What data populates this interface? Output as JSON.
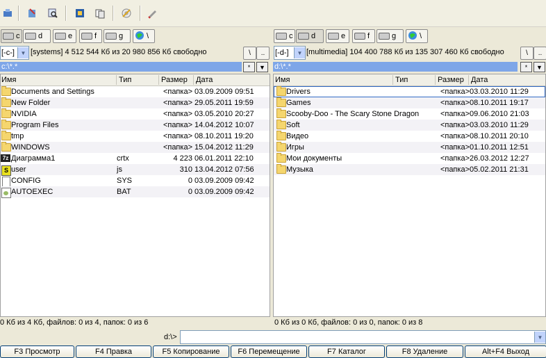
{
  "toolbar": {
    "buttons": [
      {
        "name": "network-icon"
      },
      {
        "name": "tools-icon"
      },
      {
        "name": "search-icon"
      },
      {
        "name": "windows-icon"
      },
      {
        "name": "copy-files-icon"
      },
      {
        "name": "cd-burn-icon"
      },
      {
        "name": "pen-icon"
      }
    ]
  },
  "left": {
    "drives": [
      {
        "label": "c",
        "selected": true
      },
      {
        "label": "d",
        "selected": false
      },
      {
        "label": "e",
        "selected": false
      },
      {
        "label": "f",
        "selected": false
      },
      {
        "label": "g",
        "selected": false
      },
      {
        "label": "\\",
        "selected": false
      }
    ],
    "drive_combo": "[-c-]",
    "volume_info": "[systems]  4 512 544 Кб из 20 980 856 Кб свободно",
    "path": "c:\\*.*",
    "columns": {
      "name": "Имя",
      "ext": "Тип",
      "size": "Размер",
      "date": "Дата"
    },
    "files": [
      {
        "icon": "folder",
        "name": "Documents and Settings",
        "ext": "",
        "size": "<папка>",
        "date": "03.09.2009 09:51"
      },
      {
        "icon": "folder",
        "name": "New Folder",
        "ext": "",
        "size": "<папка>",
        "date": "29.05.2011 19:59"
      },
      {
        "icon": "folder",
        "name": "NVIDIA",
        "ext": "",
        "size": "<папка>",
        "date": "03.05.2010 20:27"
      },
      {
        "icon": "folder",
        "name": "Program Files",
        "ext": "",
        "size": "<папка>",
        "date": "14.04.2012 10:07"
      },
      {
        "icon": "folder",
        "name": "tmp",
        "ext": "",
        "size": "<папка>",
        "date": "08.10.2011 19:20"
      },
      {
        "icon": "folder",
        "name": "WINDOWS",
        "ext": "",
        "size": "<папка>",
        "date": "15.04.2012 11:29"
      },
      {
        "icon": "7z",
        "name": "Диаграмма1",
        "ext": "crtx",
        "size": "4 223",
        "date": "06.01.2011 22:10"
      },
      {
        "icon": "js",
        "name": "user",
        "ext": "js",
        "size": "310",
        "date": "13.04.2012 07:56"
      },
      {
        "icon": "file",
        "name": "CONFIG",
        "ext": "SYS",
        "size": "0",
        "date": "03.09.2009 09:42"
      },
      {
        "icon": "bat",
        "name": "AUTOEXEC",
        "ext": "BAT",
        "size": "0",
        "date": "03.09.2009 09:42"
      }
    ],
    "status": "0 Кб из 4 Кб, файлов: 0 из 4, папок: 0 из 6"
  },
  "right": {
    "drives": [
      {
        "label": "c",
        "selected": false
      },
      {
        "label": "d",
        "selected": true
      },
      {
        "label": "e",
        "selected": false
      },
      {
        "label": "f",
        "selected": false
      },
      {
        "label": "g",
        "selected": false
      },
      {
        "label": "\\",
        "selected": false
      }
    ],
    "drive_combo": "[-d-]",
    "volume_info": "[multimedia]  104 400 788 Кб из 135 307 460 Кб свободно",
    "path": "d:\\*.*",
    "columns": {
      "name": "Имя",
      "ext": "Тип",
      "size": "Размер",
      "date": "Дата"
    },
    "files": [
      {
        "icon": "folder",
        "name": "Drivers",
        "ext": "",
        "size": "<папка>",
        "date": "03.03.2010 11:29"
      },
      {
        "icon": "folder",
        "name": "Games",
        "ext": "",
        "size": "<папка>",
        "date": "08.10.2011 19:17"
      },
      {
        "icon": "folder",
        "name": "Scooby-Doo - The Scary Stone Dragon",
        "ext": "",
        "size": "<папка>",
        "date": "09.06.2010 21:03"
      },
      {
        "icon": "folder",
        "name": "Soft",
        "ext": "",
        "size": "<папка>",
        "date": "03.03.2010 11:29"
      },
      {
        "icon": "folder",
        "name": "Видео",
        "ext": "",
        "size": "<папка>",
        "date": "08.10.2011 20:10"
      },
      {
        "icon": "folder",
        "name": "Игры",
        "ext": "",
        "size": "<папка>",
        "date": "01.10.2011 12:51"
      },
      {
        "icon": "folder",
        "name": "Мои документы",
        "ext": "",
        "size": "<папка>",
        "date": "26.03.2012 12:27"
      },
      {
        "icon": "folder",
        "name": "Музыка",
        "ext": "",
        "size": "<папка>",
        "date": "05.02.2011 21:31"
      }
    ],
    "status": "0 Кб из 0 Кб, файлов: 0 из 0, папок: 0 из 8"
  },
  "root_btn": "\\",
  "up_btn": "..",
  "star_btn": "*",
  "cmd": {
    "prompt": "d:\\>",
    "value": ""
  },
  "fkeys": [
    "F3 Просмотр",
    "F4 Правка",
    "F5 Копирование",
    "F6 Перемещение",
    "F7 Каталог",
    "F8 Удаление",
    "Alt+F4 Выход"
  ]
}
